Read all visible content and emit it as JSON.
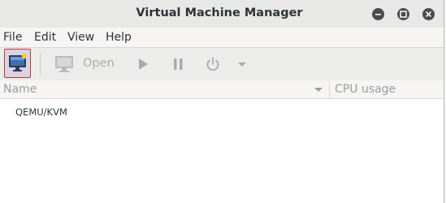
{
  "window": {
    "title": "Virtual Machine Manager"
  },
  "titlebar_buttons": [
    {
      "name": "minimize",
      "icon": "minimize-icon"
    },
    {
      "name": "maximize",
      "icon": "maximize-icon"
    },
    {
      "name": "close",
      "icon": "close-icon"
    }
  ],
  "menubar": {
    "items": [
      "File",
      "Edit",
      "View",
      "Help"
    ]
  },
  "toolbar": {
    "new_vm_icon": "new-vm-monitor-icon",
    "open_icon": "monitor-icon",
    "open_label": "Open",
    "run_icon": "play-icon",
    "pause_icon": "pause-icon",
    "shutdown_icon": "power-icon",
    "shutdown_menu_icon": "chevron-down-icon"
  },
  "table": {
    "columns": [
      "Name",
      "CPU usage"
    ],
    "rows": [
      {
        "name": "QEMU/KVM",
        "cpu_usage": ""
      }
    ]
  },
  "colors": {
    "accent_border": "#c0392b",
    "selected_bg": "#d8d3e6",
    "disabled_text": "#a9acad"
  }
}
